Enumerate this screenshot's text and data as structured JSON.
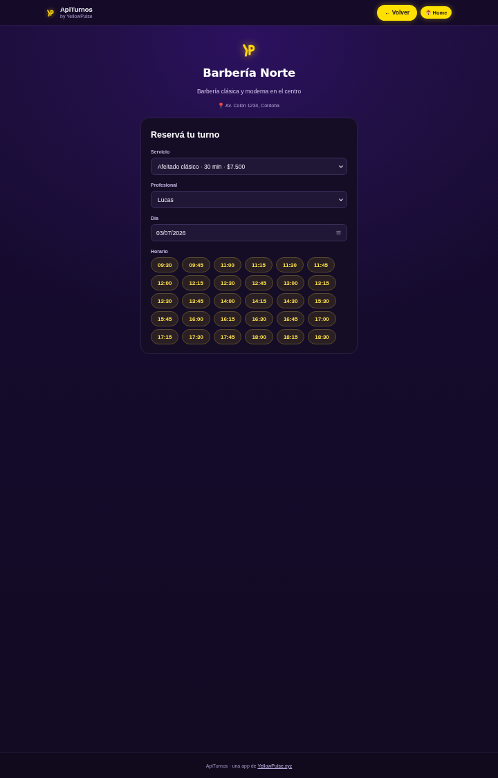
{
  "header": {
    "brand": "ApiTurnos",
    "tagline": "by YellowPulse",
    "buttons": [
      {
        "label": "← Volver",
        "kind": "back"
      },
      {
        "label": "Home",
        "kind": "home"
      }
    ]
  },
  "business": {
    "name": "Barbería Norte",
    "description": "Barbería clásica y moderna en el centro",
    "address": "Av. Colón 1234, Córdoba"
  },
  "form": {
    "title": "Reservá tu turno",
    "fields": [
      {
        "label": "Servicio",
        "kind": "select",
        "value": "Afeitado clásico · 30 min · $7.500"
      },
      {
        "label": "Profesional",
        "kind": "select",
        "value": "Lucas"
      },
      {
        "label": "Día",
        "kind": "date",
        "value": "03/07/2026"
      }
    ],
    "slots_label": "Horario",
    "slots": [
      {
        "time": "09:30",
        "selected": false
      },
      {
        "time": "09:45",
        "selected": false
      },
      {
        "time": "11:00",
        "selected": false
      },
      {
        "time": "11:15",
        "selected": false
      },
      {
        "time": "11:30",
        "selected": false
      },
      {
        "time": "11:45",
        "selected": false
      },
      {
        "time": "12:00",
        "selected": false
      },
      {
        "time": "12:15",
        "selected": false
      },
      {
        "time": "12:30",
        "selected": false
      },
      {
        "time": "12:45",
        "selected": false
      },
      {
        "time": "13:00",
        "selected": false
      },
      {
        "time": "13:15",
        "selected": false
      },
      {
        "time": "13:30",
        "selected": false
      },
      {
        "time": "13:45",
        "selected": false
      },
      {
        "time": "14:00",
        "selected": false
      },
      {
        "time": "14:15",
        "selected": false
      },
      {
        "time": "14:30",
        "selected": false
      },
      {
        "time": "15:30",
        "selected": false
      },
      {
        "time": "15:45",
        "selected": false
      },
      {
        "time": "16:00",
        "selected": false
      },
      {
        "time": "16:15",
        "selected": false
      },
      {
        "time": "16:30",
        "selected": false
      },
      {
        "time": "16:45",
        "selected": false
      },
      {
        "time": "17:00",
        "selected": false
      },
      {
        "time": "17:15",
        "selected": false
      },
      {
        "time": "17:30",
        "selected": false
      },
      {
        "time": "17:45",
        "selected": false
      },
      {
        "time": "18:00",
        "selected": false
      },
      {
        "time": "18:15",
        "selected": false
      },
      {
        "time": "18:30",
        "selected": false
      }
    ]
  },
  "footer": {
    "text": "ApiTurnos · una app de ",
    "link": "YellowPulse.xyz"
  }
}
